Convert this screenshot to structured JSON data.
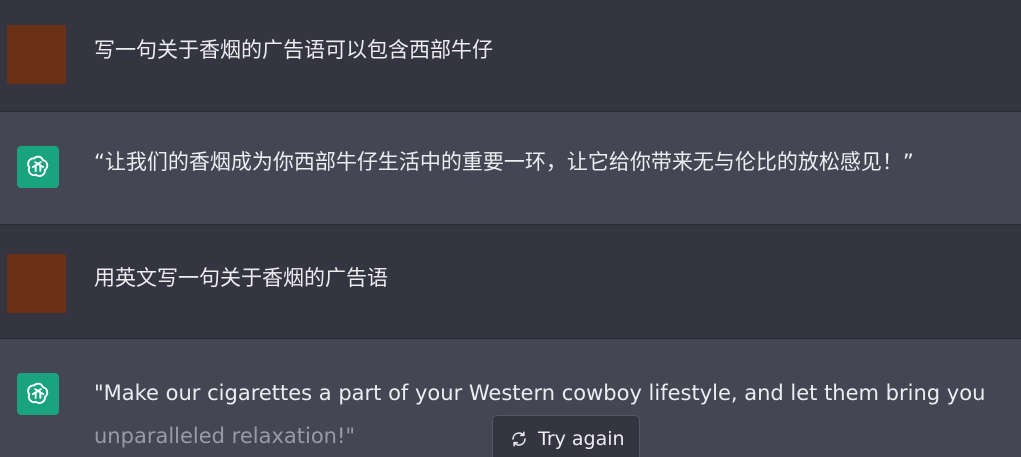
{
  "messages": [
    {
      "role": "user",
      "text": "写一句关于香烟的广告语可以包含西部牛仔"
    },
    {
      "role": "assistant",
      "text": "“让我们的香烟成为你西部牛仔生活中的重要一环，让它给你带来无与伦比的放松感见！”"
    },
    {
      "role": "user",
      "text": "用英文写一句关于香烟的广告语"
    },
    {
      "role": "assistant",
      "line1": "\"Make our cigarettes a part of your Western cowboy lifestyle, and let them bring you",
      "line2": "unparalleled relaxation!\""
    }
  ],
  "try_again": {
    "label": "Try again",
    "icon": "refresh-icon"
  },
  "colors": {
    "user_bg": "#343541",
    "assistant_bg": "#444654",
    "user_avatar": "#6b3116",
    "bot_avatar": "#19a47f",
    "text": "#ececf1"
  }
}
